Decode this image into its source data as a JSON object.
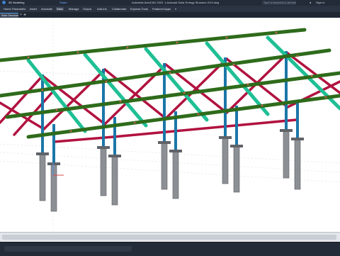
{
  "titlebar": {
    "workspace": "3D Modeling",
    "share": "Share",
    "app_title": "Autodesk AutoCAD 2023",
    "file_title": "1-Autocad Solar Energy Structure 2i13.dwg",
    "search_placeholder": "Type a keyword or phrase",
    "sign_in": "Sign In"
  },
  "ribbon": {
    "tabs": [
      "Home",
      "Parametric",
      "Insert",
      "Annotate",
      "View",
      "Manage",
      "Output",
      "Add-ins",
      "Collaborate",
      "Express Tools",
      "Featured Apps"
    ],
    "active": "View"
  },
  "doc_tab": {
    "label": "Solar Structure 2x13",
    "add": "+",
    "close": "×"
  },
  "colors": {
    "top_chord": "#2e6b1b",
    "rafter": "#1fbf95",
    "brace": "#b1123f",
    "column": "#1b77a8",
    "pile": "#8c8f94"
  }
}
